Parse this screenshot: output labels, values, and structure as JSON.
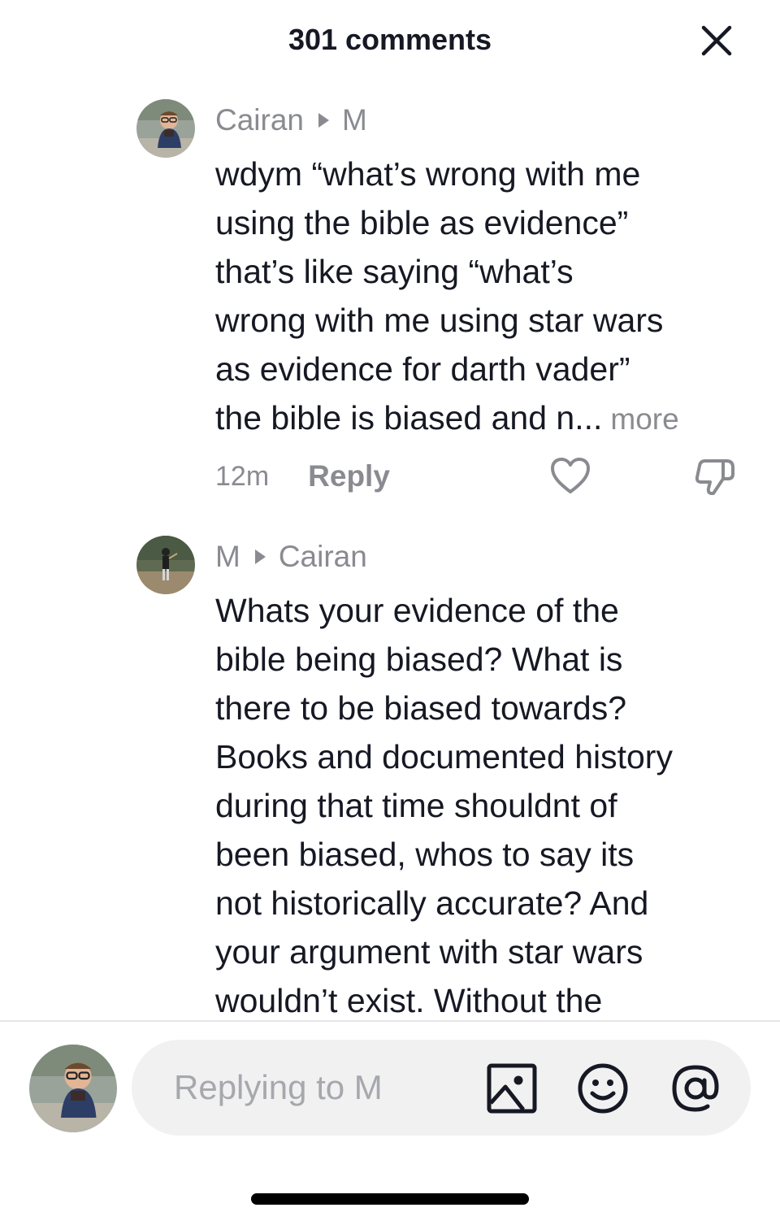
{
  "header": {
    "title": "301 comments"
  },
  "comments": [
    {
      "author": "Cairan",
      "reply_to": "M",
      "lines": [
        "wdym “what’s wrong with me",
        "using the bible as evidence”",
        "that’s like saying “what’s",
        "wrong with me using star wars",
        "as evidence for darth vader”"
      ],
      "last_line": "the bible is biased and n",
      "ellipsis": "...",
      "more_label": "more",
      "time": "12m",
      "reply_label": "Reply"
    },
    {
      "author": "M",
      "reply_to": "Cairan",
      "lines": [
        "Whats your evidence of the",
        "bible being biased? What is",
        "there to be biased towards?",
        "Books and documented history",
        "during that time shouldnt of",
        "been biased, whos to say its",
        "not historically accurate? And",
        "your argument with star wars",
        "wouldn’t exist. Without the"
      ]
    }
  ],
  "composer": {
    "placeholder": "Replying to M"
  },
  "colors": {
    "muted_text": "#8a8b91",
    "primary_text": "#161823",
    "input_bg": "#f1f1f2"
  },
  "icons": [
    "close-icon",
    "heart-icon",
    "dislike-icon",
    "image-icon",
    "emoji-icon",
    "mention-icon"
  ]
}
